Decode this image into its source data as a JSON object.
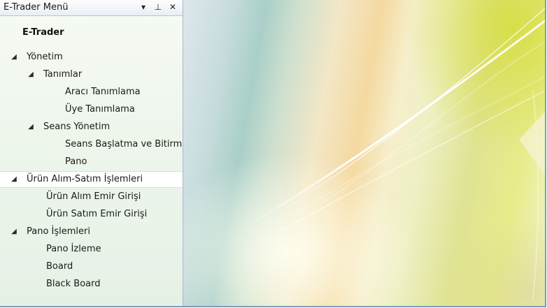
{
  "panel": {
    "title": "E-Trader Menü",
    "dropdown_icon": "chevron-down-icon",
    "pin_icon": "pin-icon",
    "close_icon": "close-icon",
    "root_label": "E-Trader"
  },
  "tree": {
    "items": [
      {
        "label": "Yönetim",
        "expanded": true,
        "level": 0
      },
      {
        "label": "Tanımlar",
        "expanded": true,
        "level": 1
      },
      {
        "label": "Aracı Tanımlama",
        "level": 3
      },
      {
        "label": "Üye Tanımlama",
        "level": 3
      },
      {
        "label": "Seans Yönetim",
        "expanded": true,
        "level": 1
      },
      {
        "label": "Seans Başlatma ve Bitirm",
        "level": 3
      },
      {
        "label": "Pano",
        "level": 3
      },
      {
        "label": "Ürün Alım-Satım İşlemleri",
        "expanded": true,
        "selected": true,
        "level": 0
      },
      {
        "label": "Ürün Alım Emir Girişi",
        "level": 2
      },
      {
        "label": "Ürün Satım Emir Girişi",
        "level": 2
      },
      {
        "label": "Pano İşlemleri",
        "expanded": true,
        "level": 0
      },
      {
        "label": "Pano İzleme",
        "level": 2
      },
      {
        "label": "Board",
        "level": 2
      },
      {
        "label": "Black Board",
        "level": 2
      }
    ]
  },
  "expander_glyph": "◢"
}
